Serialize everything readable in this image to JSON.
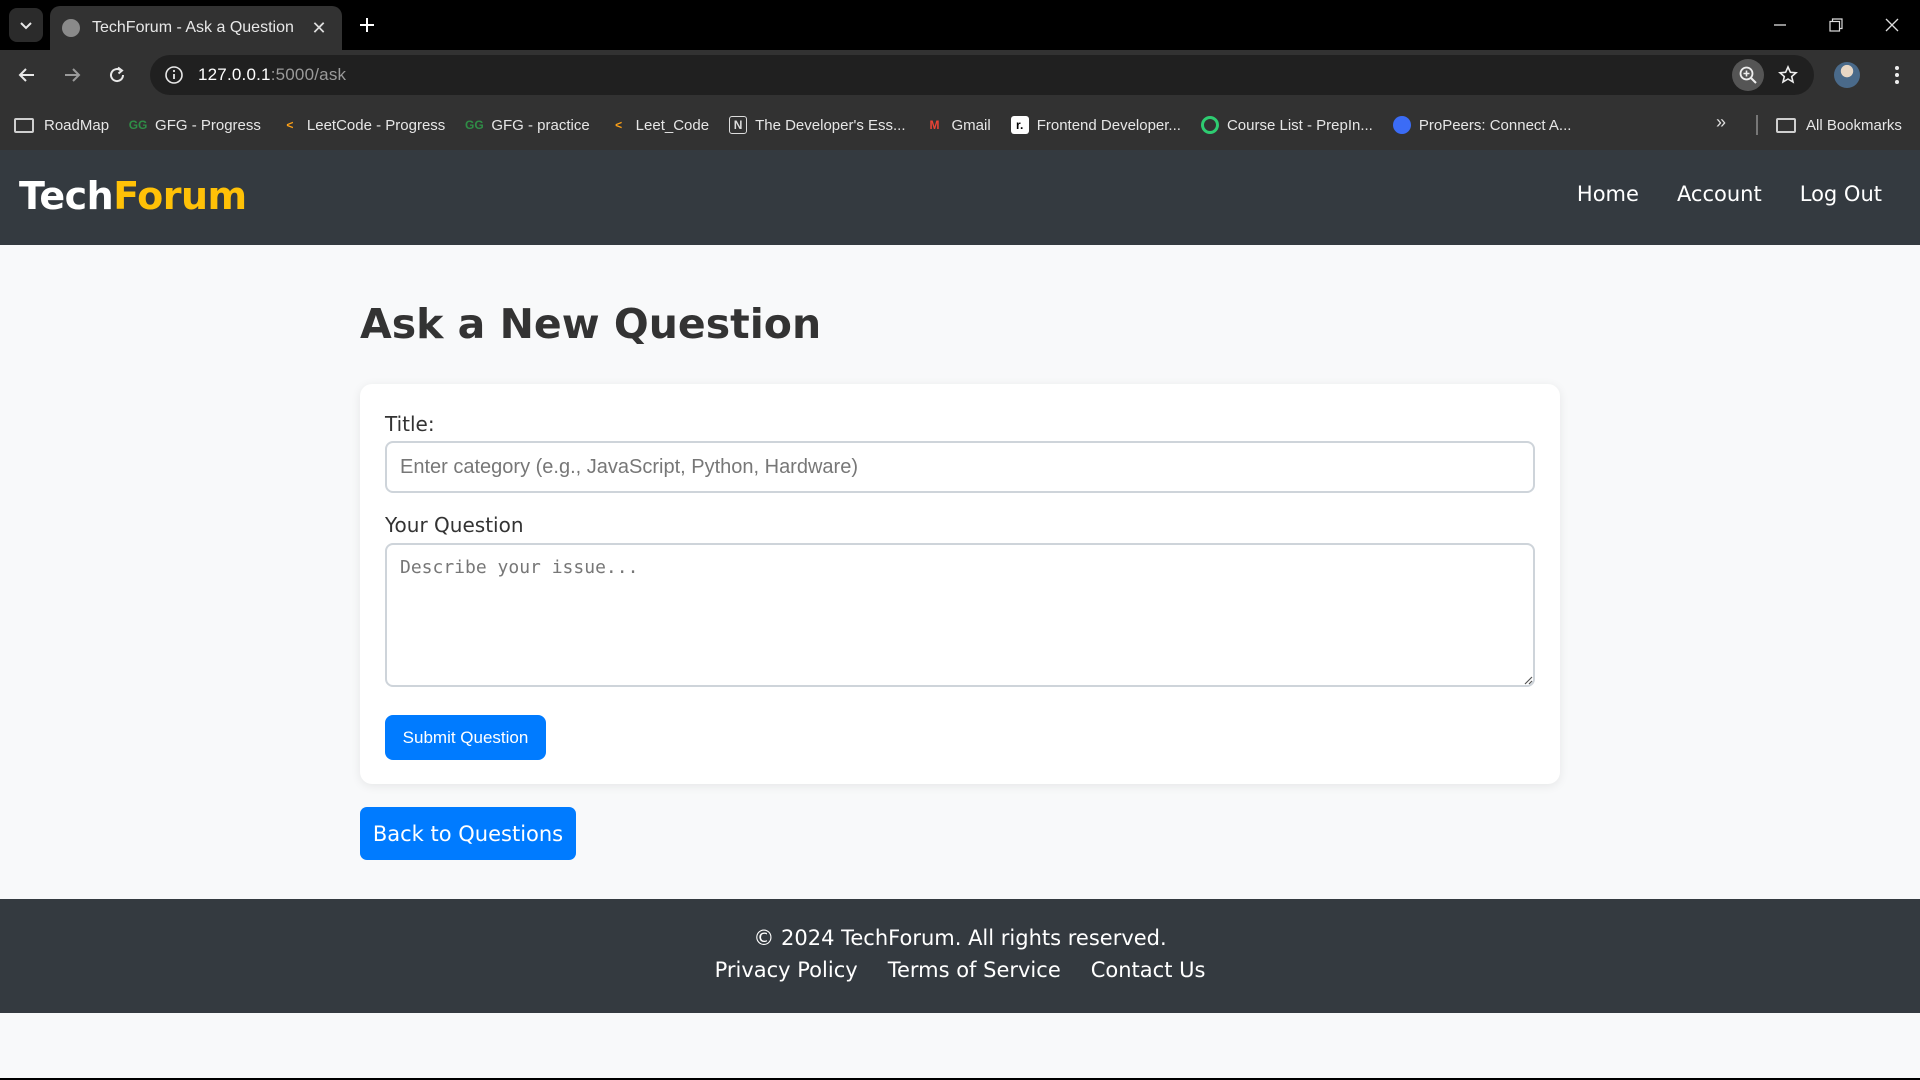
{
  "browser": {
    "tab_title": "TechForum - Ask a Question",
    "url_host": "127.0.0.1",
    "url_path": ":5000/ask",
    "bookmarks": [
      {
        "label": "RoadMap",
        "icon": "folder-icon"
      },
      {
        "label": "GFG - Progress",
        "icon": "gfg-icon"
      },
      {
        "label": "LeetCode - Progress",
        "icon": "leetcode-icon"
      },
      {
        "label": "GFG - practice",
        "icon": "gfg-icon"
      },
      {
        "label": "Leet_Code",
        "icon": "leetcode-icon"
      },
      {
        "label": "The Developer's Ess...",
        "icon": "notion-icon"
      },
      {
        "label": "Gmail",
        "icon": "gmail-icon"
      },
      {
        "label": "Frontend Developer...",
        "icon": "roadmap-icon"
      },
      {
        "label": "Course List - PrepIn...",
        "icon": "prepinsta-icon"
      },
      {
        "label": "ProPeers: Connect A...",
        "icon": "propeers-icon"
      }
    ],
    "all_bookmarks": "All Bookmarks"
  },
  "site": {
    "logo_primary": "Tech",
    "logo_accent": "Forum",
    "accent_color": "#ffc107",
    "nav": [
      "Home",
      "Account",
      "Log Out"
    ]
  },
  "page": {
    "heading": "Ask a New Question",
    "title_label": "Title:",
    "title_placeholder": "Enter category (e.g., JavaScript, Python, Hardware)",
    "title_value": "",
    "question_label": "Your Question",
    "question_placeholder": "Describe your issue...",
    "question_value": "",
    "submit_label": "Submit Question",
    "back_label": "Back to Questions",
    "primary_color": "#007bff"
  },
  "footer": {
    "copyright": "© 2024 TechForum. All rights reserved.",
    "links": [
      "Privacy Policy",
      "Terms of Service",
      "Contact Us"
    ]
  }
}
